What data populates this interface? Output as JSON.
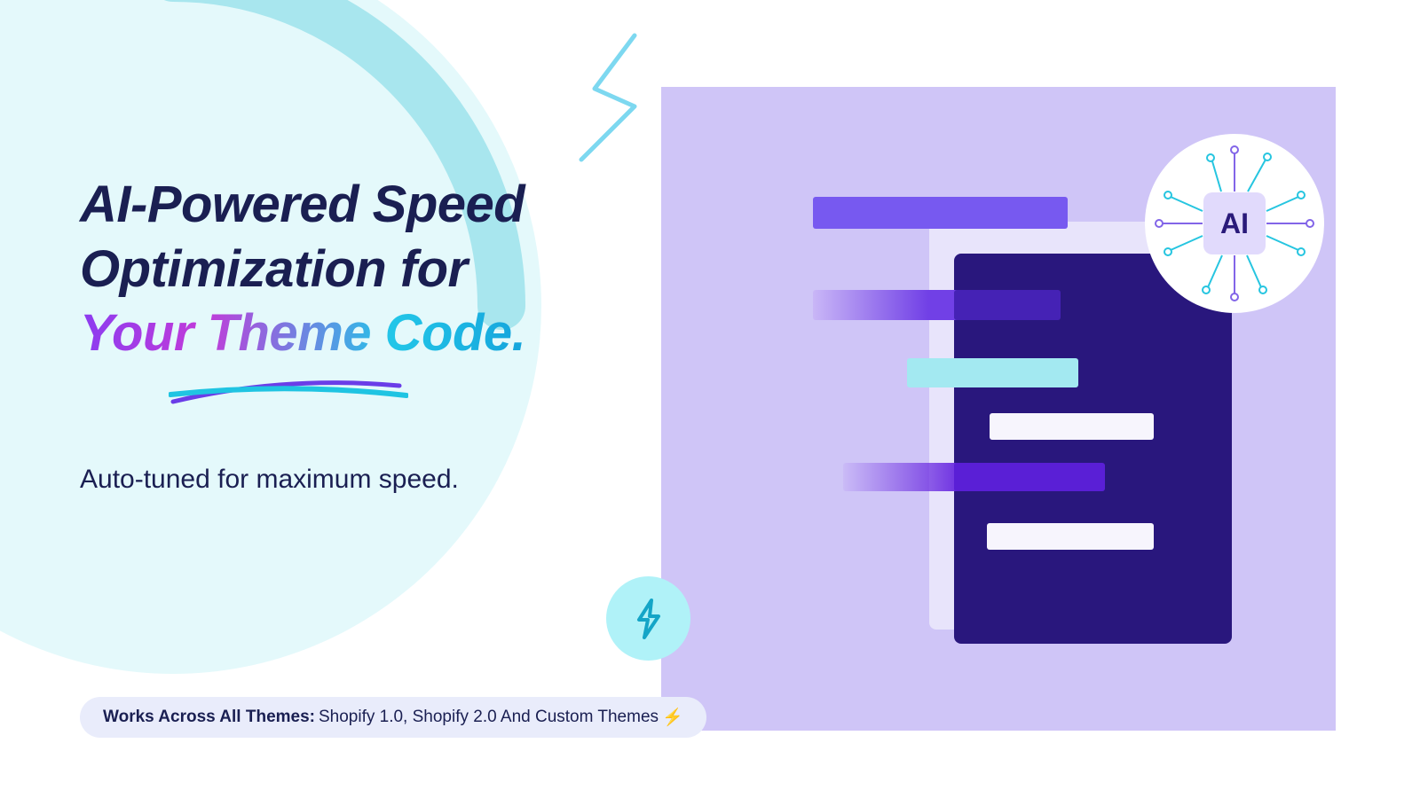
{
  "headline": {
    "line1": "AI-Powered Speed",
    "line2": "Optimization for",
    "line3_gradient": "Your Theme Code."
  },
  "subtitle": "Auto-tuned for maximum speed.",
  "pill": {
    "bold": "Works Across All Themes:",
    "rest": "Shopify 1.0, Shopify 2.0 And Custom Themes",
    "emoji": "⚡"
  },
  "ai_badge_label": "AI",
  "colors": {
    "panel": "#cfc5f7",
    "circle": "#e4f9fb",
    "dark_page": "#29177d"
  }
}
